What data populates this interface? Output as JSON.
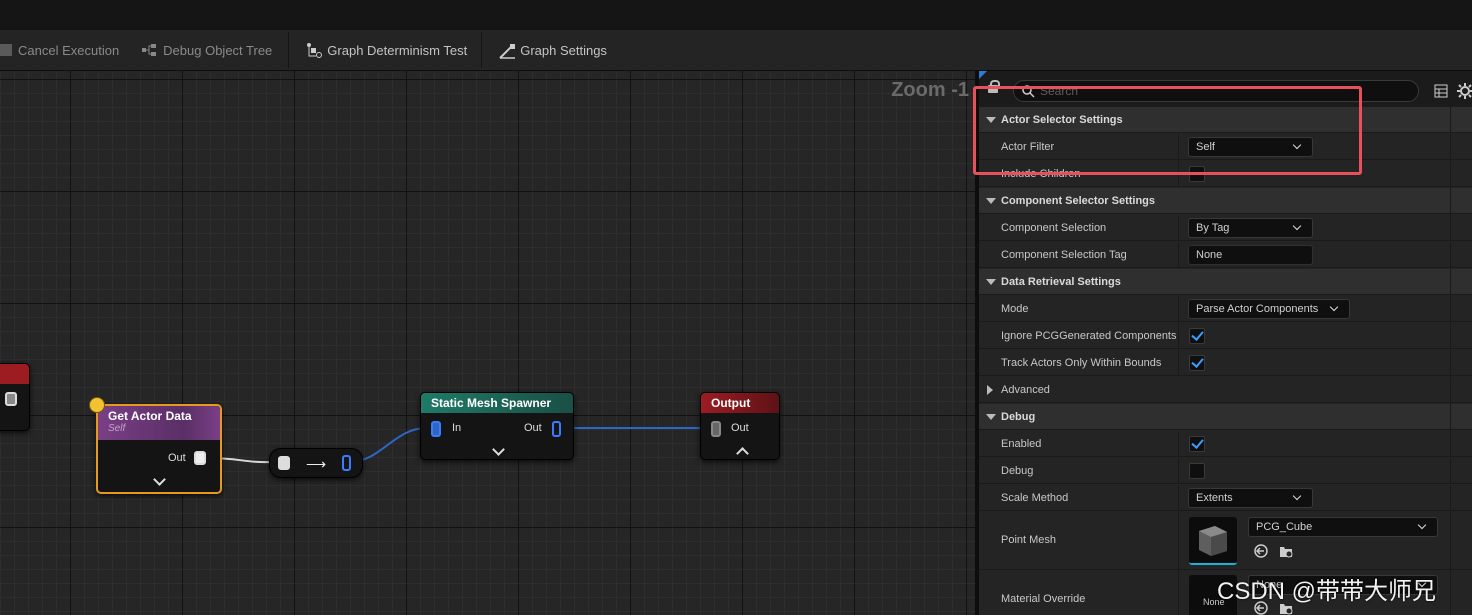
{
  "toolbar": {
    "cancel_execution": "Cancel Execution",
    "debug_object_tree": "Debug Object Tree",
    "graph_determinism_test": "Graph Determinism Test",
    "graph_settings": "Graph Settings"
  },
  "graph": {
    "zoom_text": "Zoom -1",
    "nodes": {
      "get_actor_data": {
        "title": "Get Actor Data",
        "subtitle": "Self",
        "out": "Out"
      },
      "static_mesh_spawner": {
        "title": "Static Mesh Spawner",
        "in": "In",
        "out": "Out"
      },
      "output": {
        "title": "Output",
        "out": "Out"
      }
    }
  },
  "details": {
    "search_placeholder": "Search",
    "sections": {
      "actor_selector": "Actor Selector Settings",
      "component_selector": "Component Selector Settings",
      "data_retrieval": "Data Retrieval Settings",
      "advanced": "Advanced",
      "debug": "Debug"
    },
    "props": {
      "actor_filter": {
        "label": "Actor Filter",
        "value": "Self"
      },
      "include_children": {
        "label": "Include Children",
        "checked": false
      },
      "component_selection": {
        "label": "Component Selection",
        "value": "By Tag"
      },
      "component_selection_tag": {
        "label": "Component Selection Tag",
        "value": "None"
      },
      "mode": {
        "label": "Mode",
        "value": "Parse Actor Components"
      },
      "ignore_pcg": {
        "label": "Ignore PCGGenerated Components",
        "checked": true
      },
      "track_actors": {
        "label": "Track Actors Only Within Bounds",
        "checked": true
      },
      "enabled": {
        "label": "Enabled",
        "checked": true
      },
      "debug": {
        "label": "Debug",
        "checked": false
      },
      "scale_method": {
        "label": "Scale Method",
        "value": "Extents"
      },
      "point_mesh": {
        "label": "Point Mesh",
        "value": "PCG_Cube"
      },
      "material_override": {
        "label": "Material Override",
        "thumb": "None",
        "value": "None"
      }
    }
  },
  "watermark": "CSDN @带带大师兄",
  "colors": {
    "highlight": "#e8505b",
    "get_actor_data_header": "#7a3f86",
    "get_actor_data_border": "#e39a1f",
    "spawner_header": "#1f7a68",
    "output_header": "#9c1c22",
    "checkbox_check": "#3d9cff",
    "wire_blue": "#2e66c4"
  }
}
